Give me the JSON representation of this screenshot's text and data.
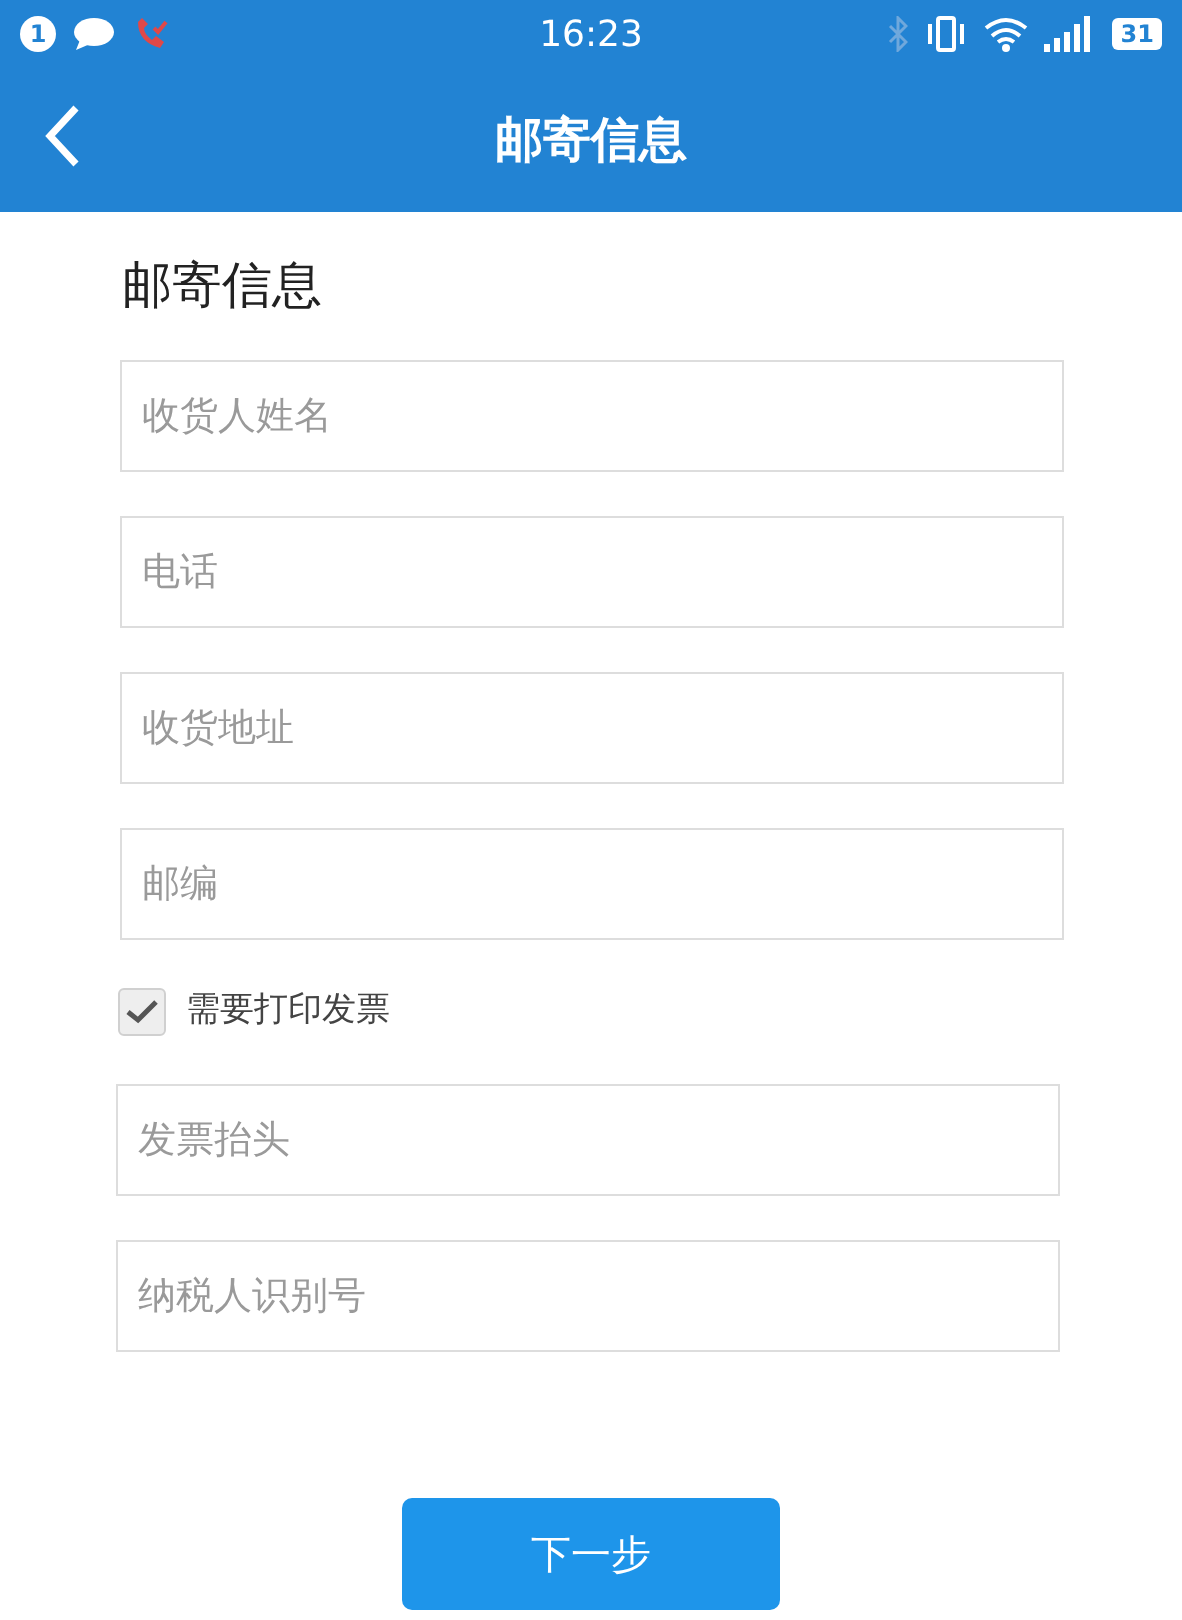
{
  "status_bar": {
    "notification_count": "1",
    "time": "16:23",
    "battery": "31"
  },
  "header": {
    "title": "邮寄信息"
  },
  "section_title": "邮寄信息",
  "fields": [
    {
      "placeholder": "收货人姓名"
    },
    {
      "placeholder": "电话"
    },
    {
      "placeholder": "收货地址"
    },
    {
      "placeholder": "邮编"
    }
  ],
  "invoice_checkbox": {
    "label": "需要打印发票",
    "checked": true
  },
  "invoice_fields": [
    {
      "placeholder": "发票抬头"
    },
    {
      "placeholder": "纳税人识别号"
    }
  ],
  "next_button": "下一步"
}
